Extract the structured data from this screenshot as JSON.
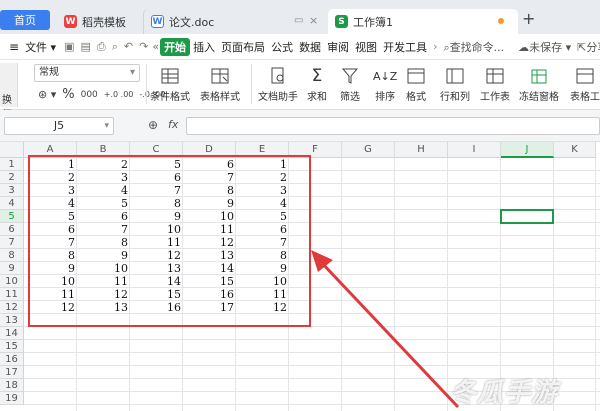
{
  "tabs": {
    "home": "首页",
    "wps": "稻壳模板",
    "doc": "论文.doc",
    "book": "工作簿1",
    "add": "+"
  },
  "menu": {
    "items": [
      "文件",
      "开始",
      "插入",
      "页面布局",
      "公式",
      "数据",
      "审阅",
      "视图",
      "开发工具"
    ],
    "search": "查找命令...",
    "unsaved": "未保存",
    "share": "分享"
  },
  "ribbon": {
    "wrap": "换行",
    "format_select": "常规",
    "percent": "%",
    "thousand": "000",
    "dec_inc": "+.0 .00",
    "dec_dec": "-.0 .00",
    "buttons": [
      "条件格式",
      "表格样式",
      "文档助手",
      "求和",
      "筛选",
      "排序",
      "格式",
      "行和列",
      "工作表",
      "冻结窗格",
      "表格工"
    ]
  },
  "formula_bar": {
    "name_box": "J5",
    "fx": "fx"
  },
  "grid": {
    "columns": [
      "A",
      "B",
      "C",
      "D",
      "E",
      "F",
      "G",
      "H",
      "I",
      "J",
      "K"
    ],
    "rows": [
      "1",
      "2",
      "3",
      "4",
      "5",
      "6",
      "7",
      "8",
      "9",
      "10",
      "11",
      "12",
      "13",
      "14",
      "15",
      "16",
      "17",
      "18",
      "19"
    ],
    "data": [
      [
        "1",
        "2",
        "5",
        "6",
        "1"
      ],
      [
        "2",
        "3",
        "6",
        "7",
        "2"
      ],
      [
        "3",
        "4",
        "7",
        "8",
        "3"
      ],
      [
        "4",
        "5",
        "8",
        "9",
        "4"
      ],
      [
        "5",
        "6",
        "9",
        "10",
        "5"
      ],
      [
        "6",
        "7",
        "10",
        "11",
        "6"
      ],
      [
        "7",
        "8",
        "11",
        "12",
        "7"
      ],
      [
        "8",
        "9",
        "12",
        "13",
        "8"
      ],
      [
        "9",
        "10",
        "13",
        "14",
        "9"
      ],
      [
        "10",
        "11",
        "14",
        "15",
        "10"
      ],
      [
        "11",
        "12",
        "15",
        "16",
        "11"
      ],
      [
        "12",
        "13",
        "16",
        "17",
        "12"
      ]
    ],
    "selected": "J5"
  },
  "colors": {
    "accent": "#3a7ef0",
    "green": "#1d9a48",
    "red": "#e03a3a"
  },
  "watermark": "冬瓜手游"
}
